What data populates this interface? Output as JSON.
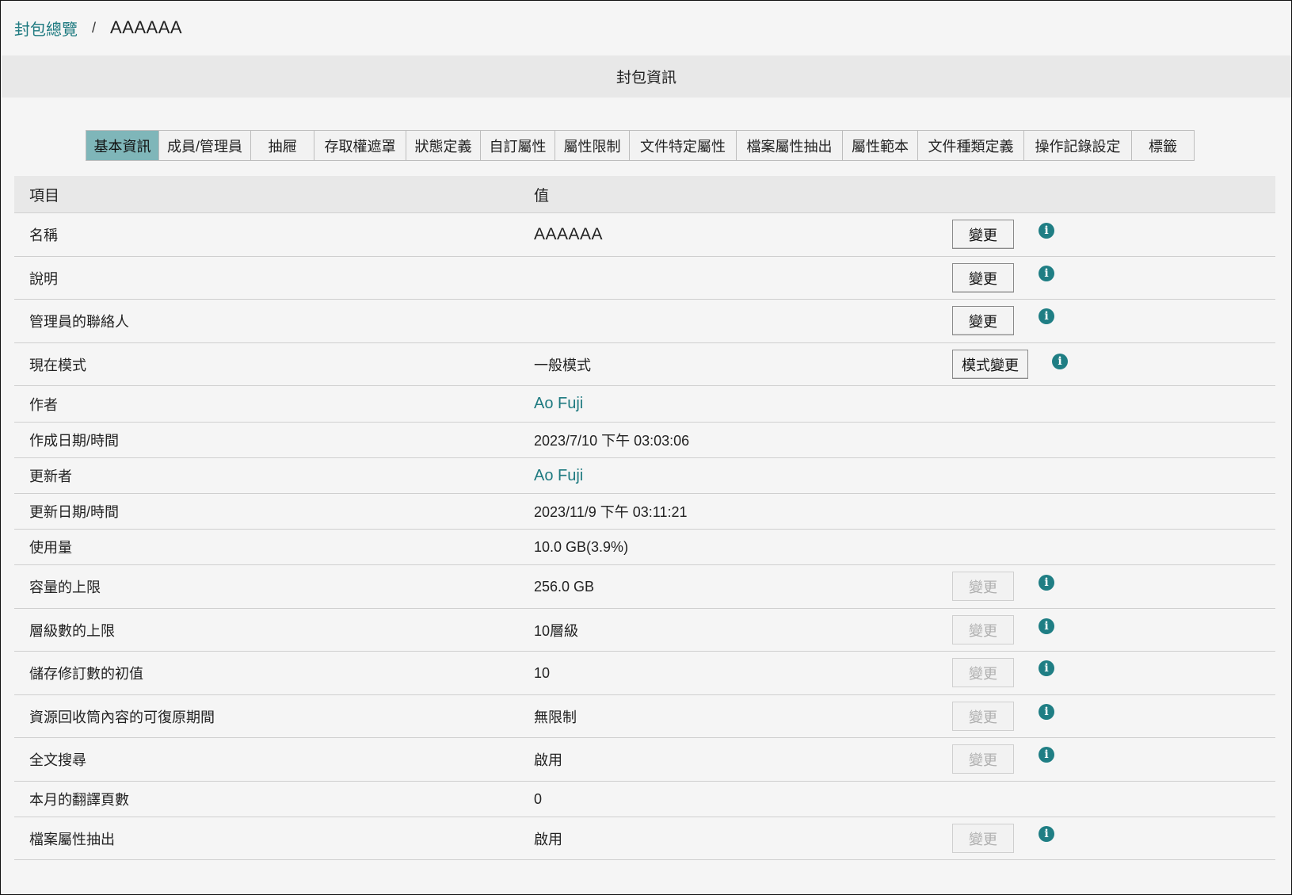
{
  "breadcrumb": {
    "link": "封包總覽",
    "separator": "/",
    "current": "AAAAAA"
  },
  "section_title": "封包資訊",
  "tabs": [
    {
      "label": "基本資訊",
      "active": true
    },
    {
      "label": "成員/管理員",
      "active": false
    },
    {
      "label": "抽屜",
      "active": false
    },
    {
      "label": "存取權遮罩",
      "active": false
    },
    {
      "label": "狀態定義",
      "active": false
    },
    {
      "label": "自訂屬性",
      "active": false
    },
    {
      "label": "屬性限制",
      "active": false
    },
    {
      "label": "文件特定屬性",
      "active": false
    },
    {
      "label": "檔案屬性抽出",
      "active": false
    },
    {
      "label": "屬性範本",
      "active": false
    },
    {
      "label": "文件種類定義",
      "active": false
    },
    {
      "label": "操作記錄設定",
      "active": false
    },
    {
      "label": "標籤",
      "active": false
    }
  ],
  "table": {
    "header_item": "項目",
    "header_value": "值",
    "rows": [
      {
        "item": "名稱",
        "value": "AAAAAA",
        "button": "變更",
        "button_enabled": true
      },
      {
        "item": "說明",
        "value": "",
        "button": "變更",
        "button_enabled": true
      },
      {
        "item": "管理員的聯絡人",
        "value": "",
        "button": "變更",
        "button_enabled": true
      },
      {
        "item": "現在模式",
        "value": "一般模式",
        "button": "模式變更",
        "button_enabled": true
      },
      {
        "item": "作者",
        "value": "Ao Fuji"
      },
      {
        "item": "作成日期/時間",
        "value": "2023/7/10 下午 03:03:06"
      },
      {
        "item": "更新者",
        "value": "Ao Fuji"
      },
      {
        "item": "更新日期/時間",
        "value": "2023/11/9 下午 03:11:21"
      },
      {
        "item": "使用量",
        "value": "10.0 GB(3.9%)"
      },
      {
        "item": "容量的上限",
        "value": "256.0 GB",
        "button": "變更",
        "button_enabled": false
      },
      {
        "item": "層級數的上限",
        "value": "10層級",
        "button": "變更",
        "button_enabled": false
      },
      {
        "item": "儲存修訂數的初值",
        "value": "10",
        "button": "變更",
        "button_enabled": false
      },
      {
        "item": "資源回收筒內容的可復原期間",
        "value": "無限制",
        "button": "變更",
        "button_enabled": false
      },
      {
        "item": "全文搜尋",
        "value": "啟用",
        "button": "變更",
        "button_enabled": false
      },
      {
        "item": "本月的翻譯頁數",
        "value": "0"
      },
      {
        "item": "檔案屬性抽出",
        "value": "啟用",
        "button": "變更",
        "button_enabled": false
      }
    ]
  },
  "icons": {
    "info": "info-icon"
  },
  "colors": {
    "accent": "#1e7a80",
    "active_tab": "#7fb6b9"
  }
}
